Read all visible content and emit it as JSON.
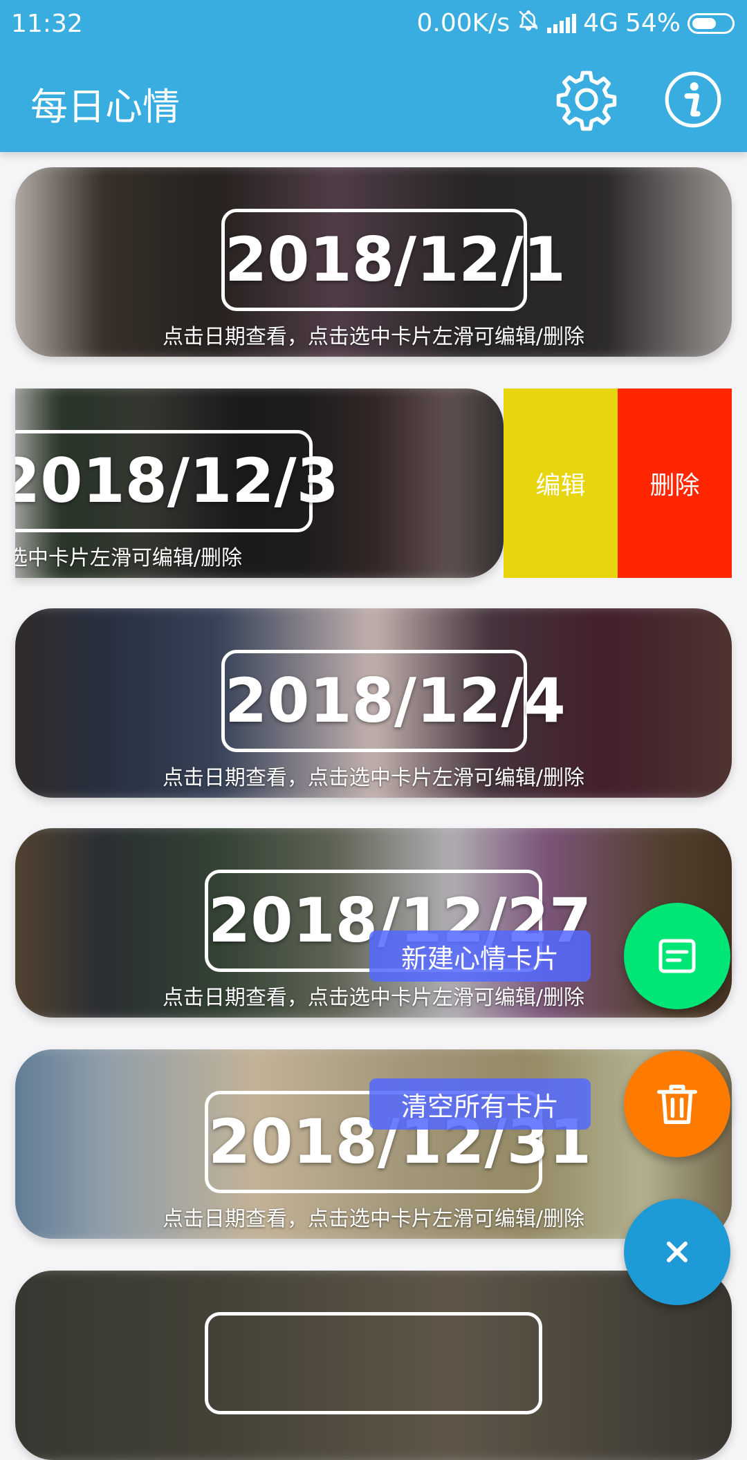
{
  "status_bar": {
    "time": "11:32",
    "net_speed": "0.00K/s",
    "network": "4G",
    "battery": "54%"
  },
  "app_bar": {
    "title": "每日心情",
    "settings_icon": "gear-icon",
    "info_icon": "info-icon"
  },
  "cards": [
    {
      "date": "2018/12/1",
      "hint": "点击日期查看，点击选中卡片左滑可编辑/删除"
    },
    {
      "date": "2018/12/3",
      "hint": "点击日期查看，点击选中卡片左滑可编辑/删除"
    },
    {
      "date": "2018/12/4",
      "hint": "点击日期查看，点击选中卡片左滑可编辑/删除"
    },
    {
      "date": "2018/12/27",
      "hint": "点击日期查看，点击选中卡片左滑可编辑/删除"
    },
    {
      "date": "2018/12/31",
      "hint": "点击日期查看，点击选中卡片左滑可编辑/删除"
    }
  ],
  "swipe_actions": {
    "edit": "编辑",
    "delete": "删除",
    "edit_color": "#e7d50d",
    "delete_color": "#ff2600"
  },
  "fab_menu": {
    "new_card_label": "新建心情卡片",
    "clear_all_label": "清空所有卡片",
    "new_color": "#00e676",
    "clear_color": "#ff7b00",
    "close_color": "#1e9bd6"
  },
  "colors": {
    "primary": "#39ade0"
  }
}
